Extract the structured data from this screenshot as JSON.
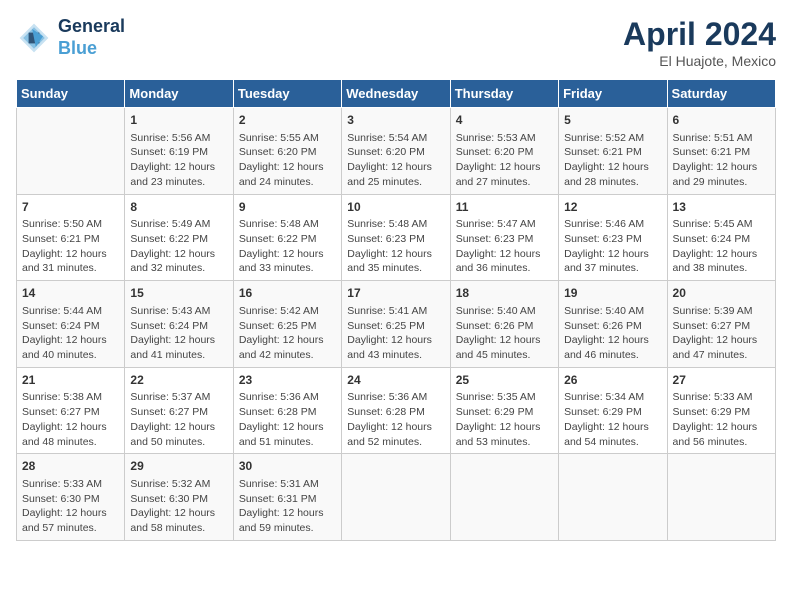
{
  "header": {
    "logo_line1": "General",
    "logo_line2": "Blue",
    "month": "April 2024",
    "location": "El Huajote, Mexico"
  },
  "weekdays": [
    "Sunday",
    "Monday",
    "Tuesday",
    "Wednesday",
    "Thursday",
    "Friday",
    "Saturday"
  ],
  "weeks": [
    [
      {
        "day": "",
        "info": ""
      },
      {
        "day": "1",
        "info": "Sunrise: 5:56 AM\nSunset: 6:19 PM\nDaylight: 12 hours\nand 23 minutes."
      },
      {
        "day": "2",
        "info": "Sunrise: 5:55 AM\nSunset: 6:20 PM\nDaylight: 12 hours\nand 24 minutes."
      },
      {
        "day": "3",
        "info": "Sunrise: 5:54 AM\nSunset: 6:20 PM\nDaylight: 12 hours\nand 25 minutes."
      },
      {
        "day": "4",
        "info": "Sunrise: 5:53 AM\nSunset: 6:20 PM\nDaylight: 12 hours\nand 27 minutes."
      },
      {
        "day": "5",
        "info": "Sunrise: 5:52 AM\nSunset: 6:21 PM\nDaylight: 12 hours\nand 28 minutes."
      },
      {
        "day": "6",
        "info": "Sunrise: 5:51 AM\nSunset: 6:21 PM\nDaylight: 12 hours\nand 29 minutes."
      }
    ],
    [
      {
        "day": "7",
        "info": "Sunrise: 5:50 AM\nSunset: 6:21 PM\nDaylight: 12 hours\nand 31 minutes."
      },
      {
        "day": "8",
        "info": "Sunrise: 5:49 AM\nSunset: 6:22 PM\nDaylight: 12 hours\nand 32 minutes."
      },
      {
        "day": "9",
        "info": "Sunrise: 5:48 AM\nSunset: 6:22 PM\nDaylight: 12 hours\nand 33 minutes."
      },
      {
        "day": "10",
        "info": "Sunrise: 5:48 AM\nSunset: 6:23 PM\nDaylight: 12 hours\nand 35 minutes."
      },
      {
        "day": "11",
        "info": "Sunrise: 5:47 AM\nSunset: 6:23 PM\nDaylight: 12 hours\nand 36 minutes."
      },
      {
        "day": "12",
        "info": "Sunrise: 5:46 AM\nSunset: 6:23 PM\nDaylight: 12 hours\nand 37 minutes."
      },
      {
        "day": "13",
        "info": "Sunrise: 5:45 AM\nSunset: 6:24 PM\nDaylight: 12 hours\nand 38 minutes."
      }
    ],
    [
      {
        "day": "14",
        "info": "Sunrise: 5:44 AM\nSunset: 6:24 PM\nDaylight: 12 hours\nand 40 minutes."
      },
      {
        "day": "15",
        "info": "Sunrise: 5:43 AM\nSunset: 6:24 PM\nDaylight: 12 hours\nand 41 minutes."
      },
      {
        "day": "16",
        "info": "Sunrise: 5:42 AM\nSunset: 6:25 PM\nDaylight: 12 hours\nand 42 minutes."
      },
      {
        "day": "17",
        "info": "Sunrise: 5:41 AM\nSunset: 6:25 PM\nDaylight: 12 hours\nand 43 minutes."
      },
      {
        "day": "18",
        "info": "Sunrise: 5:40 AM\nSunset: 6:26 PM\nDaylight: 12 hours\nand 45 minutes."
      },
      {
        "day": "19",
        "info": "Sunrise: 5:40 AM\nSunset: 6:26 PM\nDaylight: 12 hours\nand 46 minutes."
      },
      {
        "day": "20",
        "info": "Sunrise: 5:39 AM\nSunset: 6:27 PM\nDaylight: 12 hours\nand 47 minutes."
      }
    ],
    [
      {
        "day": "21",
        "info": "Sunrise: 5:38 AM\nSunset: 6:27 PM\nDaylight: 12 hours\nand 48 minutes."
      },
      {
        "day": "22",
        "info": "Sunrise: 5:37 AM\nSunset: 6:27 PM\nDaylight: 12 hours\nand 50 minutes."
      },
      {
        "day": "23",
        "info": "Sunrise: 5:36 AM\nSunset: 6:28 PM\nDaylight: 12 hours\nand 51 minutes."
      },
      {
        "day": "24",
        "info": "Sunrise: 5:36 AM\nSunset: 6:28 PM\nDaylight: 12 hours\nand 52 minutes."
      },
      {
        "day": "25",
        "info": "Sunrise: 5:35 AM\nSunset: 6:29 PM\nDaylight: 12 hours\nand 53 minutes."
      },
      {
        "day": "26",
        "info": "Sunrise: 5:34 AM\nSunset: 6:29 PM\nDaylight: 12 hours\nand 54 minutes."
      },
      {
        "day": "27",
        "info": "Sunrise: 5:33 AM\nSunset: 6:29 PM\nDaylight: 12 hours\nand 56 minutes."
      }
    ],
    [
      {
        "day": "28",
        "info": "Sunrise: 5:33 AM\nSunset: 6:30 PM\nDaylight: 12 hours\nand 57 minutes."
      },
      {
        "day": "29",
        "info": "Sunrise: 5:32 AM\nSunset: 6:30 PM\nDaylight: 12 hours\nand 58 minutes."
      },
      {
        "day": "30",
        "info": "Sunrise: 5:31 AM\nSunset: 6:31 PM\nDaylight: 12 hours\nand 59 minutes."
      },
      {
        "day": "",
        "info": ""
      },
      {
        "day": "",
        "info": ""
      },
      {
        "day": "",
        "info": ""
      },
      {
        "day": "",
        "info": ""
      }
    ]
  ]
}
